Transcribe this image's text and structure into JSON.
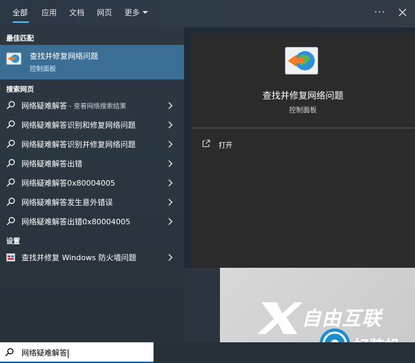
{
  "nav": {
    "tabs": [
      "全部",
      "应用",
      "文档",
      "网页",
      "更多"
    ],
    "active_tab": "全部",
    "menu_icon": "ellipsis-icon",
    "close_icon": "close-icon",
    "accent": "#4cc2ff"
  },
  "best_match": {
    "heading": "最佳匹配",
    "title": "查找并修复网络问题",
    "subtitle": "控制面板",
    "icon": "network-troubleshooter-icon",
    "highlight": "#3b6e95"
  },
  "web_search": {
    "heading": "搜索网页",
    "items": [
      {
        "label": "网络疑难解答",
        "hint": " - 查看网络搜索结果"
      },
      {
        "label": "网络疑难解答识别和修复网络问题",
        "hint": ""
      },
      {
        "label": "网络疑难解答识别并修复网络问题",
        "hint": ""
      },
      {
        "label": "网络疑难解答出错",
        "hint": ""
      },
      {
        "label": "网络疑难解答0x80004005",
        "hint": ""
      },
      {
        "label": "网络疑难解答发生意外错误",
        "hint": ""
      },
      {
        "label": "网络疑难解答出错0x80004005",
        "hint": ""
      }
    ]
  },
  "settings": {
    "heading": "设置",
    "items": [
      {
        "label": "查找并修复 Windows 防火墙问题",
        "icon": "firewall-icon"
      }
    ]
  },
  "preview": {
    "title": "查找并修复网络问题",
    "subtitle": "控制面板",
    "action_open": "打开",
    "action_icon": "open-external-icon"
  },
  "watermark": {
    "brand": "自由互联",
    "badge": "好装机"
  },
  "search": {
    "value": "网络疑难解答"
  }
}
